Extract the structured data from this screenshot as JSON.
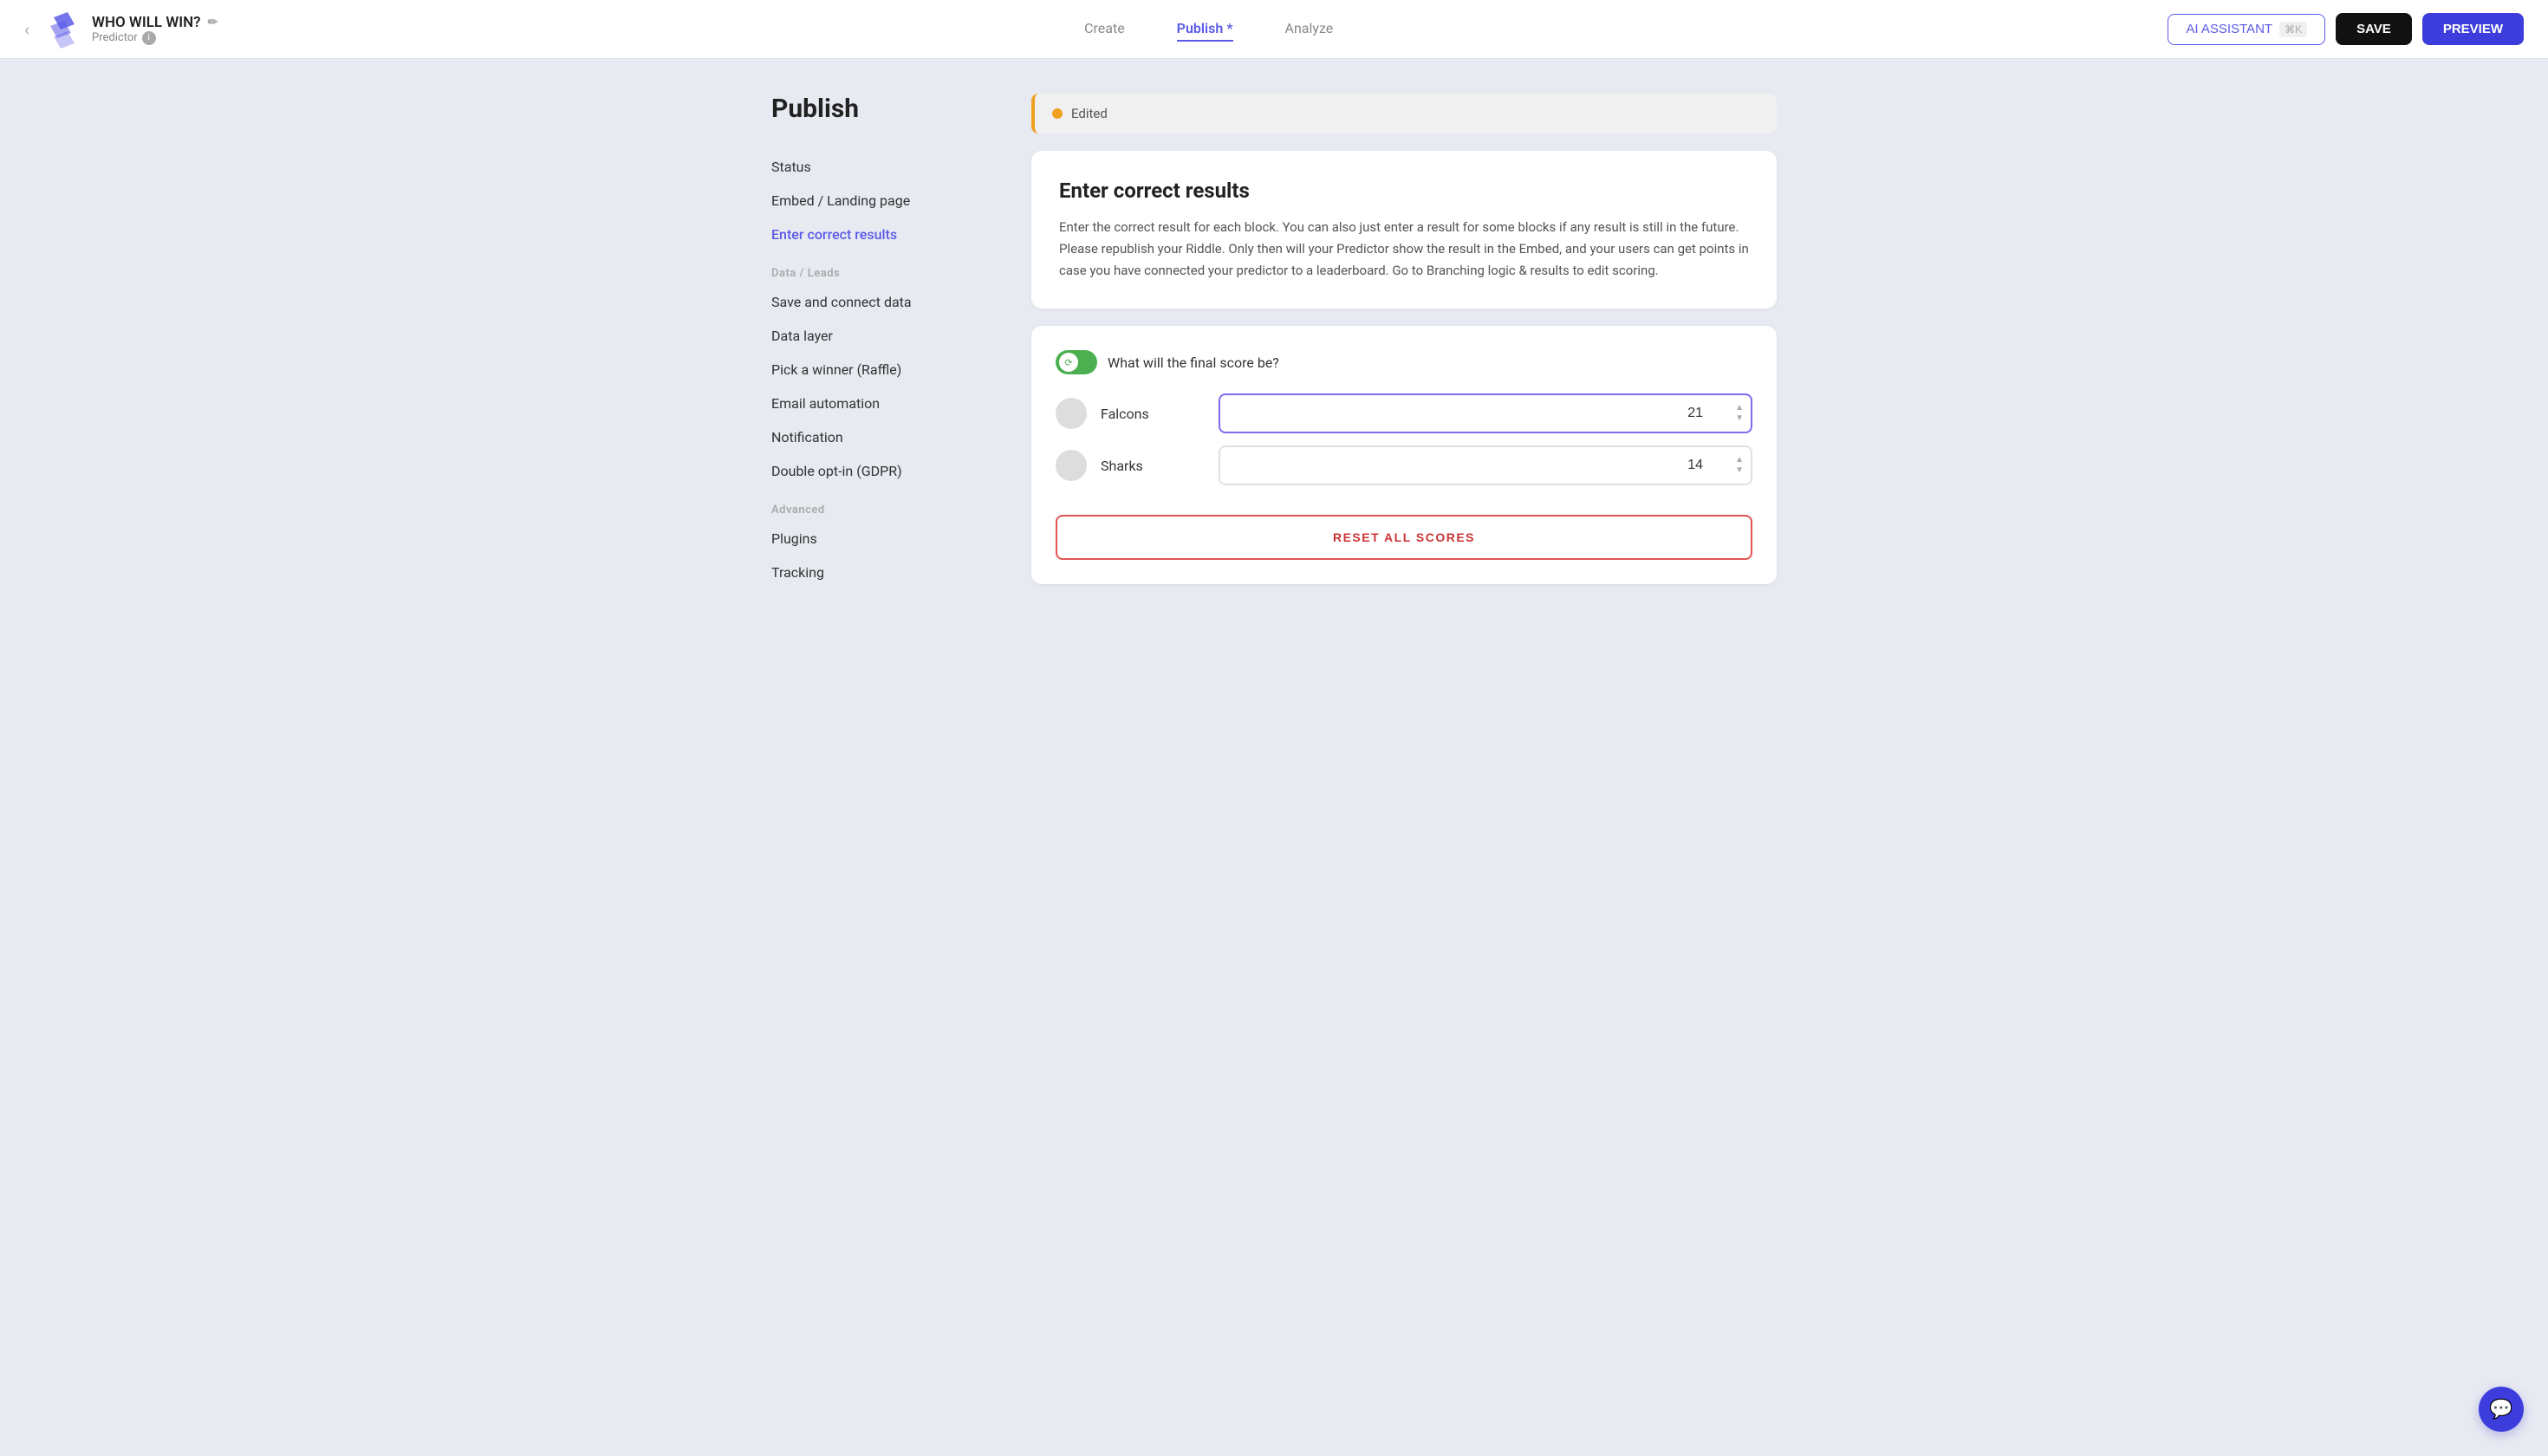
{
  "app": {
    "back_arrow": "‹",
    "project_title": "WHO WILL WIN?",
    "edit_icon": "✏",
    "project_subtitle": "Predictor",
    "info_icon": "i"
  },
  "nav": {
    "create_label": "Create",
    "publish_label": "Publish *",
    "analyze_label": "Analyze"
  },
  "header_actions": {
    "ai_label": "AI ASSISTANT",
    "ai_shortcut": "⌘K",
    "save_label": "SAVE",
    "preview_label": "PREVIEW"
  },
  "sidebar": {
    "title": "Publish",
    "items": [
      {
        "id": "status",
        "label": "Status",
        "active": false
      },
      {
        "id": "embed",
        "label": "Embed / Landing page",
        "active": false
      },
      {
        "id": "results",
        "label": "Enter correct results",
        "active": true
      }
    ],
    "data_leads_section": "Data / Leads",
    "data_items": [
      {
        "id": "save-connect",
        "label": "Save and connect data"
      },
      {
        "id": "data-layer",
        "label": "Data layer"
      },
      {
        "id": "raffle",
        "label": "Pick a winner (Raffle)"
      },
      {
        "id": "email-auto",
        "label": "Email automation"
      },
      {
        "id": "notification",
        "label": "Notification"
      },
      {
        "id": "gdpr",
        "label": "Double opt-in (GDPR)"
      }
    ],
    "advanced_section": "Advanced",
    "advanced_items": [
      {
        "id": "plugins",
        "label": "Plugins"
      },
      {
        "id": "tracking",
        "label": "Tracking"
      }
    ]
  },
  "edited_banner": {
    "text": "Edited"
  },
  "info_card": {
    "title": "Enter correct results",
    "body": "Enter the correct result for each block. You can also just enter a result for some blocks if any result is still in the future. Please republish your Riddle. Only then will your Predictor show the result in the Embed, and your users can get points in case you have connected your predictor to a leaderboard. Go to Branching logic & results to edit scoring."
  },
  "score_card": {
    "question": "What will the final score be?",
    "teams": [
      {
        "id": "falcons",
        "name": "Falcons",
        "score": "21",
        "active": true
      },
      {
        "id": "sharks",
        "name": "Sharks",
        "score": "14",
        "active": false
      }
    ],
    "reset_label": "RESET ALL SCORES"
  },
  "chat": {
    "icon": "💬"
  }
}
